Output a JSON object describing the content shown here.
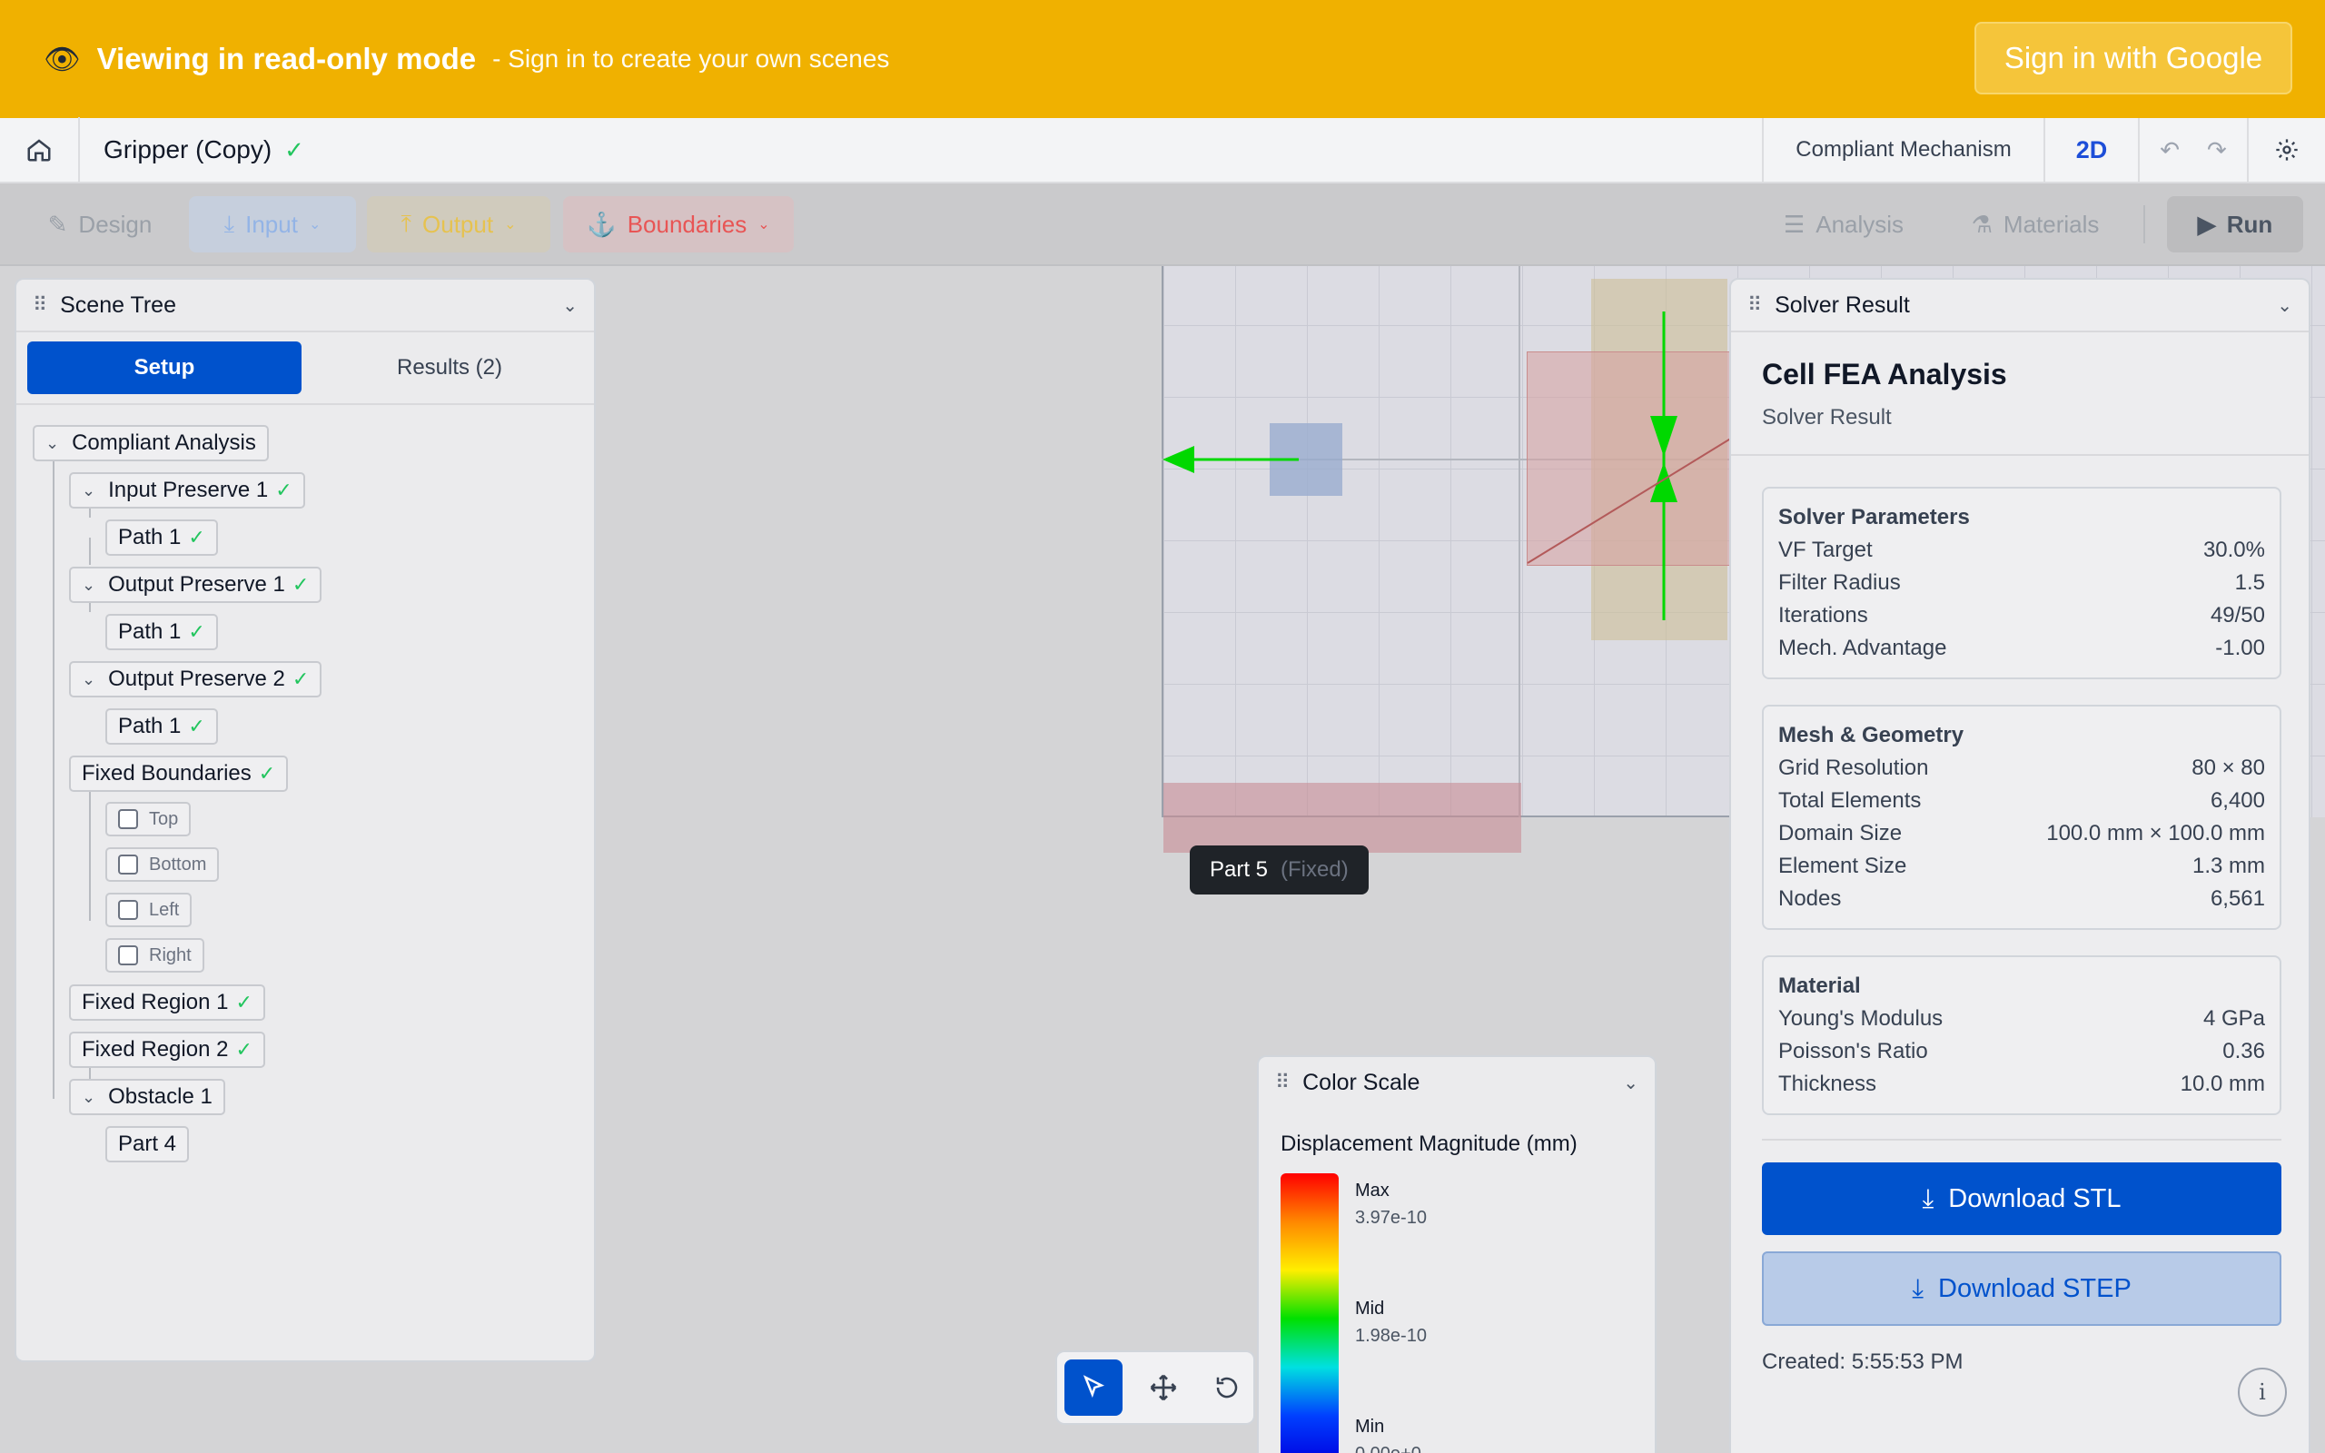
{
  "banner": {
    "title": "Viewing in read-only mode",
    "subtitle": "- Sign in to create your own scenes",
    "signin_label": "Sign in with Google"
  },
  "topbar": {
    "project_title": "Gripper (Copy)",
    "mode": "Compliant Mechanism",
    "dimension": "2D"
  },
  "toolbar": {
    "design": "Design",
    "input": "Input",
    "output": "Output",
    "boundaries": "Boundaries",
    "analysis": "Analysis",
    "materials": "Materials",
    "run": "Run"
  },
  "scene_tree": {
    "title": "Scene Tree",
    "tab_setup": "Setup",
    "tab_results": "Results (2)",
    "nodes": {
      "root": "Compliant Analysis",
      "input1": "Input Preserve 1",
      "input1_path": "Path 1",
      "output1": "Output Preserve 1",
      "output1_path": "Path 1",
      "output2": "Output Preserve 2",
      "output2_path": "Path 1",
      "fixed_boundaries": "Fixed Boundaries",
      "top": "Top",
      "bottom": "Bottom",
      "left": "Left",
      "right": "Right",
      "fixed_region1": "Fixed Region 1",
      "fixed_region2": "Fixed Region 2",
      "obstacle1": "Obstacle 1",
      "part4": "Part 4"
    }
  },
  "tooltip": {
    "name": "Part 5",
    "state": "(Fixed)"
  },
  "color_scale": {
    "title": "Color Scale",
    "heading": "Displacement Magnitude (mm)",
    "max_label": "Max",
    "max_value": "3.97e-10",
    "mid_label": "Mid",
    "mid_value": "1.98e-10",
    "min_label": "Min",
    "min_value": "0.00e+0"
  },
  "solver": {
    "panel_title": "Solver Result",
    "title": "Cell FEA Analysis",
    "subtitle": "Solver Result",
    "params_heading": "Solver Parameters",
    "params": [
      {
        "label": "VF Target",
        "value": "30.0%"
      },
      {
        "label": "Filter Radius",
        "value": "1.5"
      },
      {
        "label": "Iterations",
        "value": "49/50"
      },
      {
        "label": "Mech. Advantage",
        "value": "-1.00"
      }
    ],
    "mesh_heading": "Mesh & Geometry",
    "mesh": [
      {
        "label": "Grid Resolution",
        "value": "80 × 80"
      },
      {
        "label": "Total Elements",
        "value": "6,400"
      },
      {
        "label": "Domain Size",
        "value": "100.0 mm × 100.0 mm"
      },
      {
        "label": "Element Size",
        "value": "1.3 mm"
      },
      {
        "label": "Nodes",
        "value": "6,561"
      }
    ],
    "material_heading": "Material",
    "material": [
      {
        "label": "Young's Modulus",
        "value": "4 GPa"
      },
      {
        "label": "Poisson's Ratio",
        "value": "0.36"
      },
      {
        "label": "Thickness",
        "value": "10.0 mm"
      }
    ],
    "download_stl": "Download STL",
    "download_step": "Download STEP",
    "created": "Created: 5:55:53 PM"
  },
  "colors": {
    "banner": "#f0b100",
    "primary": "#0052cc",
    "boundaries": "#ef4444",
    "force_arrow": "#00e000"
  },
  "icons": [
    "eye-icon",
    "home-icon",
    "check-icon",
    "undo-icon",
    "redo-icon",
    "gear-icon",
    "pencil-icon",
    "download-icon",
    "upload-icon",
    "anchor-icon",
    "sliders-icon",
    "flask-icon",
    "play-icon",
    "drag-dots-icon",
    "chevron-down-icon",
    "pointer-icon",
    "move-icon",
    "rotate-icon",
    "info-icon"
  ]
}
